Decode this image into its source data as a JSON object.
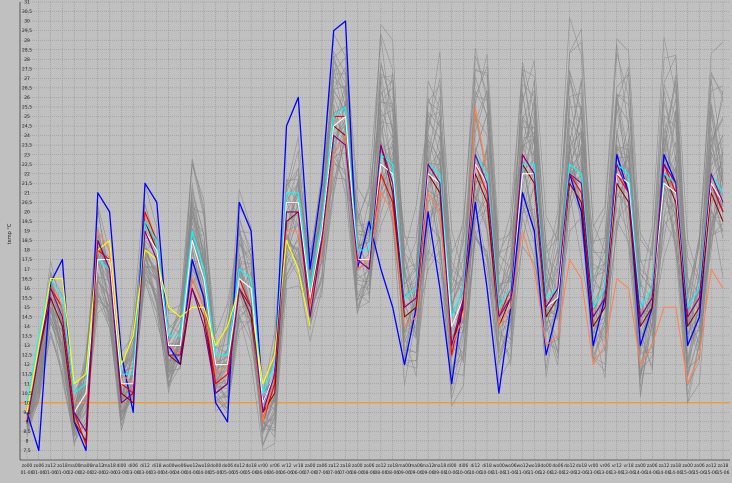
{
  "chart_data": {
    "type": "line",
    "ylabel": "temp °C",
    "ylim": [
      7,
      31
    ],
    "y_ticks": [
      7.5,
      8,
      8.5,
      9,
      9.5,
      10,
      10.5,
      11,
      11.5,
      12,
      12.5,
      13,
      13.5,
      14,
      14.5,
      15,
      15.5,
      16,
      16.5,
      17,
      17.5,
      18,
      18.5,
      19,
      19.5,
      20,
      20.5,
      21,
      21.5,
      22,
      22.5,
      23,
      23.5,
      24,
      24.5,
      25,
      25.5,
      26,
      26.5,
      27,
      27.5,
      28,
      28.5,
      29,
      29.5,
      30,
      30.5,
      31
    ],
    "y_tick_labels": [
      "7,5",
      "8",
      "8,5",
      "9",
      "9,5",
      "10",
      "10,5",
      "11",
      "11,5",
      "12",
      "12,5",
      "13",
      "13,5",
      "14",
      "14,5",
      "15",
      "15,5",
      "16",
      "16,5",
      "17",
      "17,5",
      "18",
      "18,5",
      "19",
      "19,5",
      "20",
      "20,5",
      "21",
      "21,5",
      "22",
      "22,5",
      "23",
      "23,5",
      "24",
      "24,5",
      "25",
      "25,5",
      "26",
      "26,5",
      "27",
      "27,5",
      "28",
      "28,5",
      "29",
      "29,5",
      "30",
      "30,5",
      "31"
    ],
    "x_ticks": [
      {
        "top": "zo00",
        "bottom": "01-06"
      },
      {
        "top": "zo06",
        "bottom": "01-06"
      },
      {
        "top": "zo12",
        "bottom": "01-06"
      },
      {
        "top": "zo18",
        "bottom": "01-06"
      },
      {
        "top": "ma00",
        "bottom": "02-06"
      },
      {
        "top": "ma06",
        "bottom": "02-06"
      },
      {
        "top": "ma12",
        "bottom": "02-06"
      },
      {
        "top": "ma18",
        "bottom": "02-06"
      },
      {
        "top": "di00",
        "bottom": "03-06"
      },
      {
        "top": "di06",
        "bottom": "03-06"
      },
      {
        "top": "di12",
        "bottom": "03-06"
      },
      {
        "top": "di18",
        "bottom": "03-06"
      },
      {
        "top": "wo00",
        "bottom": "04-06"
      },
      {
        "top": "wo06",
        "bottom": "04-06"
      },
      {
        "top": "wo12",
        "bottom": "04-06"
      },
      {
        "top": "wo18",
        "bottom": "04-06"
      },
      {
        "top": "do00",
        "bottom": "05-06"
      },
      {
        "top": "do06",
        "bottom": "05-06"
      },
      {
        "top": "do12",
        "bottom": "05-06"
      },
      {
        "top": "do18",
        "bottom": "05-06"
      },
      {
        "top": "vr00",
        "bottom": "06-06"
      },
      {
        "top": "vr06",
        "bottom": "06-06"
      },
      {
        "top": "vr12",
        "bottom": "06-06"
      },
      {
        "top": "vr18",
        "bottom": "06-06"
      },
      {
        "top": "za00",
        "bottom": "07-06"
      },
      {
        "top": "za06",
        "bottom": "07-06"
      },
      {
        "top": "za12",
        "bottom": "07-06"
      },
      {
        "top": "za18",
        "bottom": "07-06"
      },
      {
        "top": "zo00",
        "bottom": "08-06"
      },
      {
        "top": "zo06",
        "bottom": "08-06"
      },
      {
        "top": "zo12",
        "bottom": "08-06"
      },
      {
        "top": "zo18",
        "bottom": "08-06"
      },
      {
        "top": "ma00",
        "bottom": "09-06"
      },
      {
        "top": "ma06",
        "bottom": "09-06"
      },
      {
        "top": "ma12",
        "bottom": "09-06"
      },
      {
        "top": "ma18",
        "bottom": "09-06"
      },
      {
        "top": "di00",
        "bottom": "10-06"
      },
      {
        "top": "di06",
        "bottom": "10-06"
      },
      {
        "top": "di12",
        "bottom": "10-06"
      },
      {
        "top": "di18",
        "bottom": "10-06"
      },
      {
        "top": "wo00",
        "bottom": "11-06"
      },
      {
        "top": "wo06",
        "bottom": "11-06"
      },
      {
        "top": "wo12",
        "bottom": "11-06"
      },
      {
        "top": "wo18",
        "bottom": "11-06"
      },
      {
        "top": "do00",
        "bottom": "12-06"
      },
      {
        "top": "do06",
        "bottom": "12-06"
      },
      {
        "top": "do12",
        "bottom": "12-06"
      },
      {
        "top": "do18",
        "bottom": "12-06"
      },
      {
        "top": "vr00",
        "bottom": "13-06"
      },
      {
        "top": "vr06",
        "bottom": "13-06"
      },
      {
        "top": "vr12",
        "bottom": "13-06"
      },
      {
        "top": "vr18",
        "bottom": "13-06"
      },
      {
        "top": "za00",
        "bottom": "14-06"
      },
      {
        "top": "za06",
        "bottom": "14-06"
      },
      {
        "top": "za12",
        "bottom": "14-06"
      },
      {
        "top": "za18",
        "bottom": "14-06"
      },
      {
        "top": "zo00",
        "bottom": "15-06"
      },
      {
        "top": "zo06",
        "bottom": "15-06"
      },
      {
        "top": "zo12",
        "bottom": "15-06"
      },
      {
        "top": "zo18",
        "bottom": "15-06"
      }
    ],
    "grid": true,
    "background_color": "#c0c0c0",
    "grid_color": "#8c8c8c",
    "reference_line": {
      "y": 10,
      "color": "#ff8c00"
    },
    "ensemble": {
      "color": "#8a8a8a",
      "members": 40,
      "mean": [
        9.0,
        11.5,
        15.5,
        13.5,
        9.0,
        11.0,
        17.5,
        16.0,
        10.5,
        12.0,
        18.5,
        17.0,
        12.5,
        13.5,
        19.5,
        17.5,
        11.5,
        12.0,
        17.5,
        16.0,
        9.5,
        10.5,
        19.0,
        20.0,
        16.0,
        19.0,
        25.0,
        25.0,
        18.0,
        18.0,
        24.5,
        24.0,
        15.0,
        15.5,
        23.0,
        22.5,
        14.5,
        15.5,
        23.5,
        23.0,
        15.0,
        16.0,
        24.0,
        23.5,
        15.5,
        16.0,
        24.0,
        23.5,
        15.0,
        16.0,
        23.5,
        23.0,
        14.5,
        15.5,
        23.0,
        22.5,
        14.5,
        15.5,
        23.0,
        22.5
      ],
      "amplitude": [
        0.5,
        1.0,
        1.5,
        1.5,
        1.0,
        1.5,
        2.0,
        1.5,
        1.5,
        1.5,
        2.0,
        2.0,
        1.5,
        1.5,
        2.5,
        2.0,
        1.5,
        2.0,
        2.5,
        2.5,
        1.5,
        2.0,
        2.5,
        2.5,
        2.0,
        2.5,
        3.0,
        3.0,
        2.5,
        2.5,
        3.5,
        3.5,
        3.0,
        3.0,
        4.0,
        4.0,
        3.0,
        3.0,
        4.0,
        4.0,
        3.0,
        3.0,
        4.0,
        4.0,
        3.0,
        3.0,
        4.0,
        4.0,
        3.0,
        3.0,
        4.0,
        4.0,
        3.0,
        3.0,
        4.0,
        4.0,
        3.0,
        3.0,
        4.0,
        4.0
      ]
    },
    "series": [
      {
        "color": "#0000ff",
        "width": 1.3,
        "values": [
          9.5,
          7.5,
          16.3,
          17.5,
          9.0,
          7.5,
          21.0,
          20.0,
          12.5,
          9.5,
          21.5,
          20.5,
          13.0,
          12.0,
          17.5,
          15.5,
          10.0,
          9.0,
          20.5,
          19.0,
          10.0,
          11.5,
          24.5,
          26.0,
          17.0,
          21.5,
          29.5,
          30.0,
          17.0,
          19.5,
          17.0,
          15.0,
          12.0,
          15.0,
          20.0,
          16.0,
          11.0,
          15.5,
          20.5,
          16.0,
          10.5,
          15.0,
          21.0,
          19.0,
          12.5,
          15.0,
          22.0,
          20.0,
          13.0,
          15.5,
          23.0,
          21.0,
          13.0,
          15.0,
          23.0,
          21.5,
          13.0,
          14.5,
          21.5,
          20.0
        ]
      },
      {
        "color": "#ff0000",
        "width": 1.1,
        "values": [
          9.5,
          13.0,
          16.0,
          15.0,
          9.5,
          7.8,
          18.0,
          17.5,
          11.0,
          10.5,
          20.0,
          18.5,
          13.0,
          12.5,
          16.5,
          15.0,
          11.0,
          11.5,
          16.5,
          15.0,
          9.0,
          11.0,
          20.5,
          20.5,
          15.0,
          19.0,
          25.0,
          25.0,
          17.5,
          17.5,
          22.0,
          20.5,
          15.0,
          15.5,
          22.5,
          21.5,
          12.5,
          15.5,
          22.5,
          21.0,
          14.5,
          16.0,
          23.0,
          22.0,
          15.0,
          16.0,
          22.0,
          21.0,
          14.5,
          15.5,
          22.0,
          21.0,
          14.5,
          15.5,
          22.5,
          21.0,
          14.5,
          15.5,
          21.5,
          20.0
        ]
      },
      {
        "color": "#8b0000",
        "width": 1.0,
        "values": [
          9.0,
          12.5,
          15.5,
          14.0,
          9.0,
          8.0,
          18.5,
          17.0,
          10.5,
          10.0,
          19.5,
          18.0,
          12.5,
          12.0,
          16.0,
          14.5,
          10.5,
          11.0,
          16.0,
          14.5,
          9.5,
          10.5,
          19.5,
          20.0,
          15.5,
          18.5,
          24.5,
          24.0,
          17.5,
          17.0,
          23.5,
          21.0,
          14.5,
          15.0,
          22.0,
          21.0,
          13.0,
          15.0,
          22.0,
          20.5,
          14.0,
          15.5,
          22.5,
          21.5,
          14.5,
          15.5,
          21.5,
          20.5,
          14.0,
          15.0,
          21.5,
          20.5,
          14.0,
          15.0,
          22.0,
          20.5,
          14.0,
          15.0,
          21.0,
          19.5
        ]
      },
      {
        "color": "#ff8050",
        "width": 1.0,
        "values": [
          9.0,
          13.0,
          16.5,
          15.0,
          10.0,
          10.0,
          19.0,
          18.0,
          11.5,
          11.0,
          19.0,
          18.0,
          13.0,
          12.5,
          16.5,
          15.0,
          11.5,
          12.0,
          16.0,
          15.0,
          9.0,
          11.5,
          19.0,
          19.0,
          15.0,
          18.0,
          23.0,
          24.0,
          17.0,
          17.5,
          21.0,
          20.0,
          14.0,
          14.5,
          21.0,
          20.0,
          13.0,
          14.5,
          25.5,
          22.0,
          14.0,
          15.0,
          19.0,
          17.0,
          13.0,
          13.5,
          17.5,
          16.5,
          12.0,
          13.0,
          16.5,
          16.0,
          12.0,
          13.0,
          15.0,
          15.0,
          11.0,
          12.5,
          17.0,
          16.0
        ]
      },
      {
        "color": "#00ffff",
        "width": 1.1,
        "values": [
          10.0,
          13.5,
          16.5,
          15.5,
          10.5,
          11.0,
          17.5,
          17.0,
          11.5,
          11.5,
          19.5,
          18.5,
          13.5,
          13.5,
          19.0,
          17.0,
          12.5,
          12.5,
          17.0,
          16.5,
          10.5,
          12.0,
          21.0,
          21.0,
          16.0,
          19.5,
          25.0,
          25.5,
          18.0,
          18.0,
          23.0,
          22.5,
          15.5,
          16.0,
          22.5,
          22.0,
          14.5,
          16.0,
          23.0,
          22.0,
          15.0,
          16.0,
          22.5,
          22.5,
          15.5,
          16.0,
          22.5,
          22.0,
          15.0,
          16.0,
          22.5,
          22.0,
          15.0,
          16.0,
          22.0,
          21.5,
          15.0,
          16.0,
          22.0,
          21.0
        ]
      },
      {
        "color": "#ffffff",
        "width": 1.0,
        "values": [
          9.5,
          13.0,
          16.0,
          14.5,
          9.5,
          10.5,
          17.5,
          17.5,
          11.0,
          11.0,
          19.0,
          18.0,
          13.0,
          13.0,
          18.5,
          16.5,
          12.0,
          12.0,
          16.5,
          16.0,
          10.0,
          11.5,
          20.5,
          20.5,
          15.5,
          19.0,
          24.5,
          25.0,
          17.5,
          17.5,
          22.5,
          22.0,
          15.0,
          15.5,
          22.0,
          21.5,
          14.0,
          15.5,
          22.5,
          21.5,
          14.5,
          15.5,
          22.0,
          22.0,
          15.0,
          15.5,
          22.0,
          21.5,
          14.5,
          15.5,
          22.0,
          21.5,
          14.5,
          15.5,
          21.5,
          21.0,
          14.5,
          15.5,
          21.5,
          20.5
        ]
      },
      {
        "color": "#ffff00",
        "width": 1.1,
        "values": [
          9.5,
          13.0,
          16.5,
          16.5,
          11.0,
          11.5,
          18.0,
          18.5,
          12.0,
          13.5,
          18.0,
          17.5,
          15.0,
          14.5,
          15.0,
          15.0,
          13.0,
          14.0,
          16.0,
          15.0,
          11.0,
          12.5,
          18.5,
          17.0,
          14.0
        ]
      },
      {
        "color": "#800080",
        "width": 1.1,
        "values": [
          9.0,
          12.5,
          16.0,
          14.5,
          9.5,
          8.5,
          18.5,
          17.0,
          10.0,
          10.5,
          19.0,
          17.5,
          12.5,
          12.5,
          16.0,
          14.0,
          10.5,
          11.0,
          16.0,
          15.0,
          9.5,
          11.5,
          20.0,
          20.0,
          14.5,
          18.5,
          24.0,
          23.5,
          17.5,
          17.0,
          23.5,
          21.5,
          15.0,
          15.5,
          22.5,
          21.5,
          13.0,
          15.5,
          23.0,
          21.5,
          14.5,
          15.5,
          23.0,
          22.0,
          15.0,
          16.0,
          22.0,
          21.5,
          14.5,
          15.5,
          22.5,
          21.0,
          14.5,
          15.5,
          22.5,
          21.5,
          14.5,
          15.5,
          22.0,
          20.5
        ]
      }
    ]
  }
}
